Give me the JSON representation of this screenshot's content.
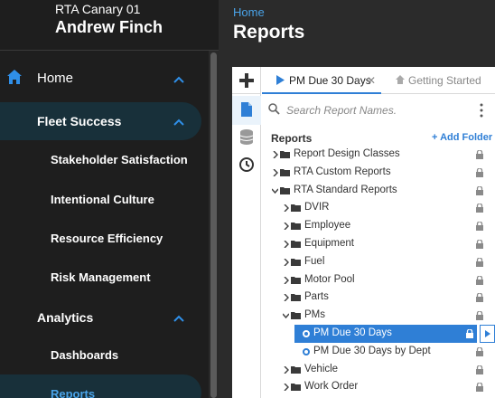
{
  "sidebar": {
    "org_name": "RTA Canary 01",
    "user_name": "Andrew Finch",
    "home_label": "Home",
    "fleet_label": "Fleet Success",
    "fleet_items": [
      "Stakeholder Satisfaction",
      "Intentional Culture",
      "Resource Efficiency",
      "Risk Management"
    ],
    "analytics_label": "Analytics",
    "analytics_items": [
      "Dashboards",
      "Reports"
    ]
  },
  "header": {
    "breadcrumb": "Home",
    "title": "Reports"
  },
  "tabs": [
    {
      "label": "PM Due 30 Days",
      "active": true
    },
    {
      "label": "Getting Started",
      "active": false
    }
  ],
  "search": {
    "placeholder": "Search Report Names."
  },
  "reports": {
    "title": "Reports",
    "add_folder": "+ Add Folder",
    "tree": [
      {
        "label": "Report Design Classes",
        "type": "folder",
        "expanded": false
      },
      {
        "label": "RTA Custom Reports",
        "type": "folder",
        "expanded": false
      },
      {
        "label": "RTA Standard Reports",
        "type": "folder",
        "expanded": true
      },
      {
        "label": "DVIR",
        "type": "folder",
        "expanded": false
      },
      {
        "label": "Employee",
        "type": "folder",
        "expanded": false
      },
      {
        "label": "Equipment",
        "type": "folder",
        "expanded": false
      },
      {
        "label": "Fuel",
        "type": "folder",
        "expanded": false
      },
      {
        "label": "Motor Pool",
        "type": "folder",
        "expanded": false
      },
      {
        "label": "Parts",
        "type": "folder",
        "expanded": false
      },
      {
        "label": "PMs",
        "type": "folder",
        "expanded": true
      },
      {
        "label": "PM Due 30 Days",
        "type": "report",
        "selected": true
      },
      {
        "label": "PM Due 30 Days by Dept",
        "type": "report",
        "selected": false
      },
      {
        "label": "Vehicle",
        "type": "folder",
        "expanded": false
      },
      {
        "label": "Work Order",
        "type": "folder",
        "expanded": false
      }
    ]
  },
  "colors": {
    "accent": "#2f7fd6",
    "sidebar_bg": "#1e1e1e",
    "active_nav_bg": "#18303a",
    "link": "#4aa3e8"
  }
}
